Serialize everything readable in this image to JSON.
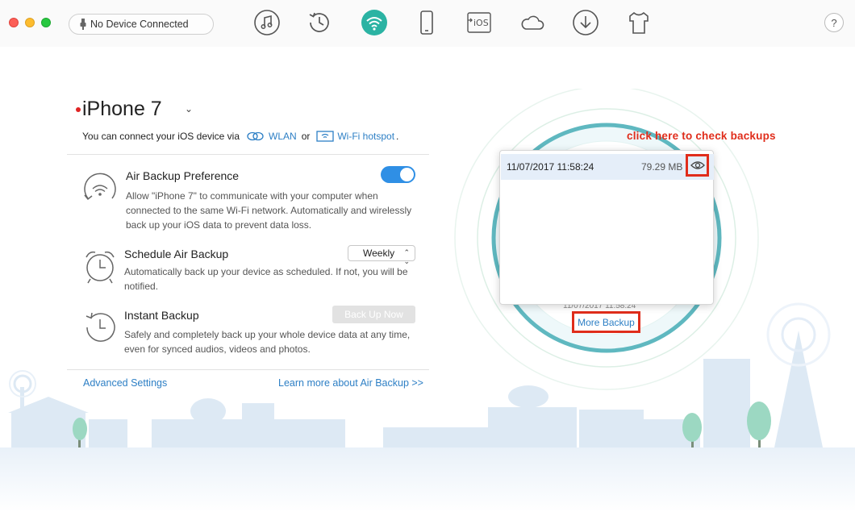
{
  "toolbar": {
    "device_status": "No Device Connected",
    "icons": [
      "music-icon",
      "history-icon",
      "wifi-icon",
      "phone-icon",
      "ios-icon",
      "cloud-icon",
      "download-icon",
      "shirt-icon"
    ],
    "help_label": "?"
  },
  "device": {
    "name": "iPhone 7",
    "connect_prefix": "You can connect your iOS device via",
    "wlan_label": "WLAN",
    "or_label": "or",
    "hotspot_label": "Wi-Fi hotspot",
    "period": "."
  },
  "options": {
    "air_backup": {
      "title": "Air Backup Preference",
      "desc": "Allow \"iPhone 7\" to communicate with your computer when connected to the same Wi-Fi network. Automatically and wirelessly back up your iOS data to prevent data loss.",
      "enabled": true
    },
    "schedule": {
      "title": "Schedule Air Backup",
      "desc": "Automatically back up your device as scheduled. If not, you will be notified.",
      "selected": "Weekly"
    },
    "instant": {
      "title": "Instant Backup",
      "desc": "Safely and completely back up your whole device data at any time, even for synced audios, videos and photos.",
      "button": "Back Up Now"
    }
  },
  "footer": {
    "advanced": "Advanced Settings",
    "learn_more": "Learn more about Air Backup >>"
  },
  "backups": {
    "rows": [
      {
        "date": "11/07/2017 11:58:24",
        "size": "79.29 MB"
      }
    ],
    "behind_text": "11/07/2017 11:58:24",
    "more_label": "More Backup"
  },
  "annotation": {
    "text": "click here to check backups"
  },
  "colors": {
    "accent": "#2f8fe5",
    "link": "#2d7fc5",
    "annotation": "#e02d1b",
    "ring": "#5fb8c0"
  }
}
